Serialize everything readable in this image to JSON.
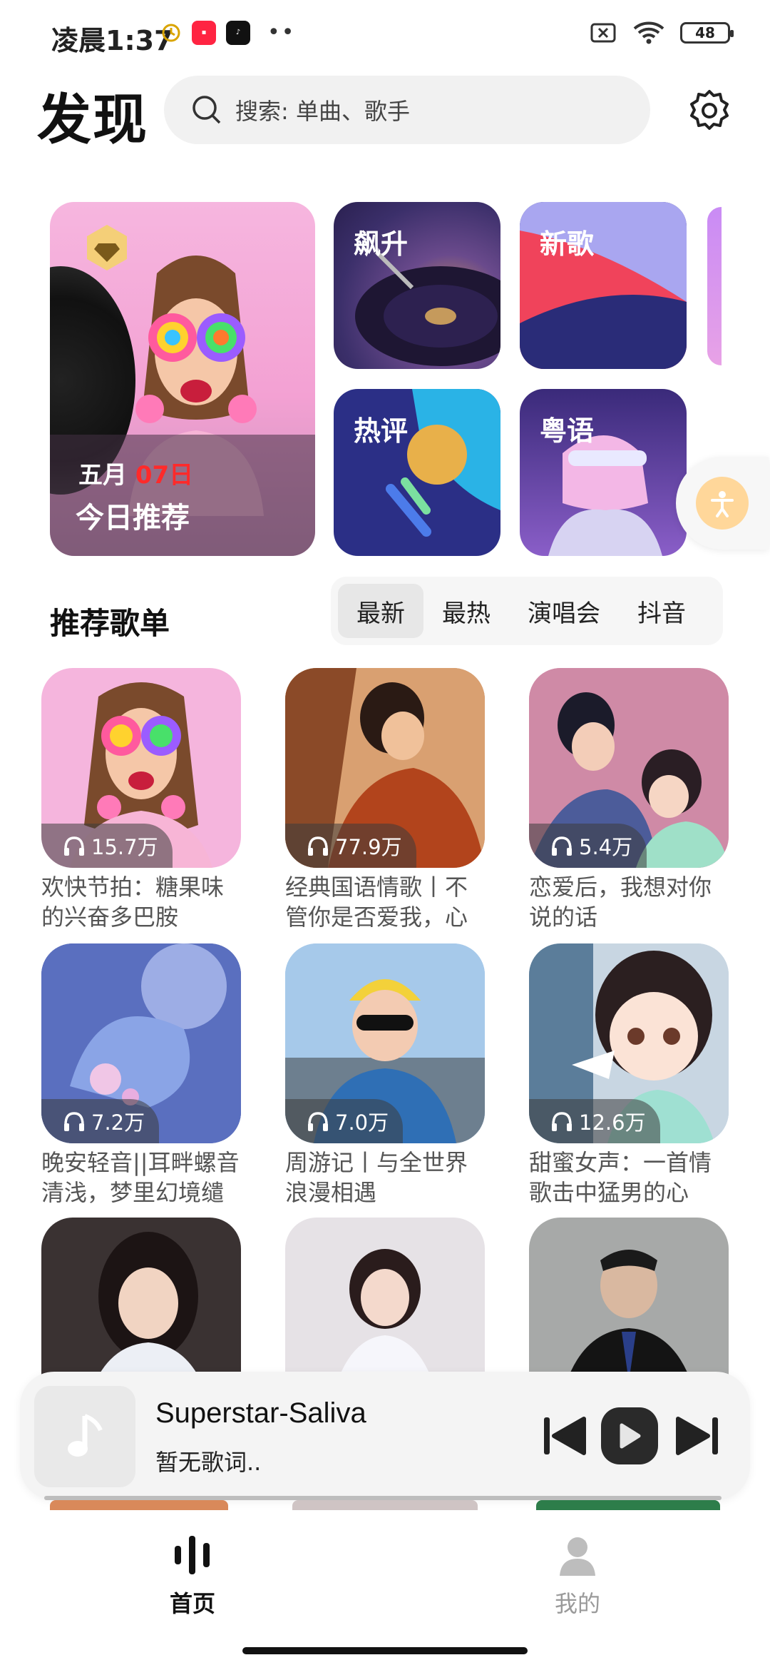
{
  "status_bar": {
    "time": "凌晨1:37",
    "battery": "48"
  },
  "header": {
    "title": "发现",
    "search_placeholder": "搜索: 单曲、歌手"
  },
  "featured": {
    "month": "五月",
    "day": "07日",
    "label": "今日推荐",
    "tiles": [
      {
        "label": "飙升"
      },
      {
        "label": "新歌"
      },
      {
        "label": "热评"
      },
      {
        "label": "粤语"
      }
    ]
  },
  "section": {
    "title": "推荐歌单",
    "tabs": [
      "最新",
      "最热",
      "演唱会",
      "抖音"
    ]
  },
  "playlists": [
    {
      "count": "15.7万",
      "title": "欢快节拍：糖果味的兴奋多巴胺"
    },
    {
      "count": "77.9万",
      "title": "经典国语情歌丨不管你是否爱我，心"
    },
    {
      "count": "5.4万",
      "title": "恋爱后，我想对你说的话"
    },
    {
      "count": "7.2万",
      "title": "晚安轻音||耳畔螺音清浅，梦里幻境缱"
    },
    {
      "count": "7.0万",
      "title": "周游记丨与全世界浪漫相遇"
    },
    {
      "count": "12.6万",
      "title": "甜蜜女声：一首情歌击中猛男的心"
    }
  ],
  "player": {
    "title": "Superstar-Saliva",
    "lyrics": "暂无歌词.."
  },
  "nav": {
    "home": "首页",
    "mine": "我的"
  },
  "colors": {
    "accent": "#111111",
    "bar_bg": "#f4f4f4",
    "date_red": "#ff2a2a"
  }
}
